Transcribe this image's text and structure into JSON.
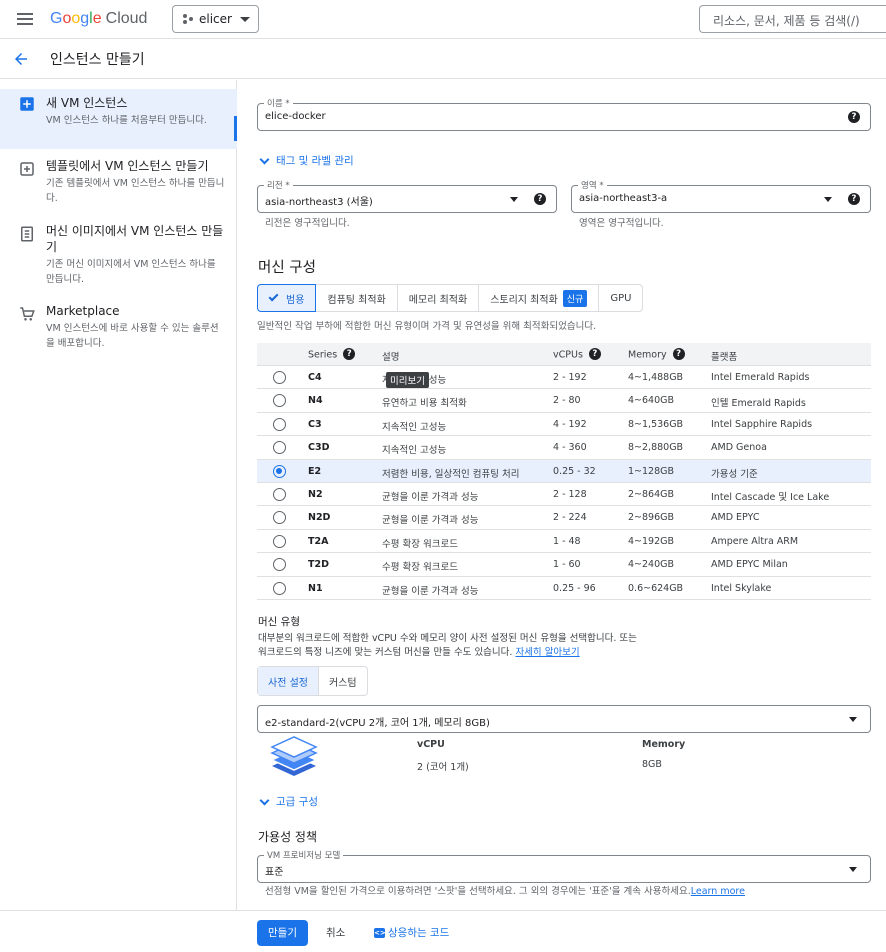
{
  "topbar": {
    "logo_letters": [
      "G",
      "o",
      "o",
      "g",
      "l",
      "e"
    ],
    "logo_cloud": "Cloud",
    "project": "elicer",
    "search_placeholder": "리소스, 문서, 제품 등 검색(/)"
  },
  "page": {
    "title": "인스턴스 만들기"
  },
  "sidebar": {
    "items": [
      {
        "title": "새 VM 인스턴스",
        "desc": "VM 인스턴스 하나를 처음부터 만듭니다.",
        "icon": "plus-box-icon",
        "active": true
      },
      {
        "title": "템플릿에서 VM 인스턴스 만들기",
        "desc": "기존 템플릿에서 VM 인스턴스 하나를 만듭니다.",
        "icon": "template-icon",
        "active": false
      },
      {
        "title": "머신 이미지에서 VM 인스턴스 만들기",
        "desc": "기존 머신 이미지에서 VM 인스턴스 하나를 만듭니다.",
        "icon": "machine-image-icon",
        "active": false
      },
      {
        "title": "Marketplace",
        "desc": "VM 인스턴스에 바로 사용할 수 있는 솔루션을 배포합니다.",
        "icon": "cart-icon",
        "active": false
      }
    ]
  },
  "form": {
    "name_label": "이름 *",
    "name_value": "elice-docker",
    "labels_toggle": "태그 및 라벨 관리",
    "region_label": "리전 *",
    "region_value": "asia-northeast3 (서울)",
    "region_hint": "리전은 영구적입니다.",
    "zone_label": "영역 *",
    "zone_value": "asia-northeast3-a",
    "zone_hint": "영역은 영구적입니다."
  },
  "machine_config": {
    "title": "머신 구성",
    "tabs": [
      "범용",
      "컴퓨팅 최적화",
      "메모리 최적화",
      "스토리지 최적화",
      "GPU"
    ],
    "new_badge": "신규",
    "tab_desc": "일반적인 작업 부하에 적합한 머신 유형이며 가격 및 유연성을 위해 최적화되었습니다.",
    "columns": {
      "series": "Series",
      "desc": "설명",
      "vcpus": "vCPUs",
      "memory": "Memory",
      "platform": "플랫폼"
    },
    "tooltip": "미리보기",
    "rows": [
      {
        "series": "C4",
        "desc": "지속적인 고성능",
        "vcpus": "2 - 192",
        "memory": "4~1,488GB",
        "platform": "Intel Emerald Rapids"
      },
      {
        "series": "N4",
        "desc": "유연하고 비용 최적화",
        "vcpus": "2 - 80",
        "memory": "4~640GB",
        "platform": "인텔 Emerald Rapids"
      },
      {
        "series": "C3",
        "desc": "지속적인 고성능",
        "vcpus": "4 - 192",
        "memory": "8~1,536GB",
        "platform": "Intel Sapphire Rapids"
      },
      {
        "series": "C3D",
        "desc": "지속적인 고성능",
        "vcpus": "4 - 360",
        "memory": "8~2,880GB",
        "platform": "AMD Genoa"
      },
      {
        "series": "E2",
        "desc": "저렴한 비용, 일상적인 컴퓨팅 처리",
        "vcpus": "0.25 - 32",
        "memory": "1~128GB",
        "platform": "가용성 기준"
      },
      {
        "series": "N2",
        "desc": "균형을 이룬 가격과 성능",
        "vcpus": "2 - 128",
        "memory": "2~864GB",
        "platform": "Intel Cascade 및 Ice Lake"
      },
      {
        "series": "N2D",
        "desc": "균형을 이룬 가격과 성능",
        "vcpus": "2 - 224",
        "memory": "2~896GB",
        "platform": "AMD EPYC"
      },
      {
        "series": "T2A",
        "desc": "수평 확장 워크로드",
        "vcpus": "1 - 48",
        "memory": "4~192GB",
        "platform": "Ampere Altra ARM"
      },
      {
        "series": "T2D",
        "desc": "수평 확장 워크로드",
        "vcpus": "1 - 60",
        "memory": "4~240GB",
        "platform": "AMD EPYC Milan"
      },
      {
        "series": "N1",
        "desc": "균형을 이룬 가격과 성능",
        "vcpus": "0.25 - 96",
        "memory": "0.6~624GB",
        "platform": "Intel Skylake"
      }
    ],
    "selected_series": "E2"
  },
  "machine_type": {
    "title": "머신 유형",
    "desc_line1": "대부분의 워크로드에 적합한 vCPU 수와 메모리 양이 사전 설정된 머신 유형을 선택합니다. 또는",
    "desc_line2": "워크로드의 특정 니즈에 맞는 커스텀 머신을 만들 수도 있습니다.",
    "learn_more": "자세히 알아보기",
    "segments": [
      "사전 설정",
      "커스텀"
    ],
    "selected": "e2-standard-2(vCPU 2개, 코어 1개, 메모리 8GB)",
    "vcpu_label": "vCPU",
    "vcpu_value": "2 (코어 1개)",
    "memory_label": "Memory",
    "memory_value": "8GB",
    "advanced": "고급 구성"
  },
  "availability": {
    "title": "가용성 정책",
    "model_label": "VM 프로비저닝 모델",
    "model_value": "표준",
    "hint": "선점형 VM을 할인된 가격으로 이용하려면 '스팟'을 선택하세요. 그 외의 경우에는 '표준'을 계속 사용하세요.",
    "learn_more": "Learn more"
  },
  "footer": {
    "create": "만들기",
    "cancel": "취소",
    "code": "상응하는 코드"
  },
  "colors": {
    "accent": "#1a73e8",
    "selected_bg": "#e8f0fe"
  }
}
